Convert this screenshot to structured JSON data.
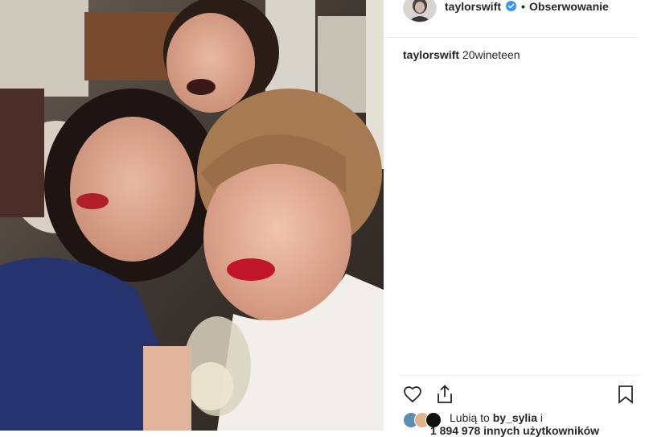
{
  "post": {
    "username": "taylorswift",
    "separator": "•",
    "follow_status": "Obserwowanie",
    "caption_user": "taylorswift",
    "caption_text": "20wineteen"
  },
  "likes": {
    "prefix": "Lubią to",
    "user": "by_sylia",
    "suffix": "i",
    "others": "1 894 978 innych użytkowników"
  },
  "icons": {
    "verified": "verified-badge-icon",
    "like": "heart-icon",
    "share": "share-icon",
    "save": "bookmark-icon"
  },
  "colors": {
    "verified_blue": "#3897f0",
    "text": "#262626",
    "divider": "#efefef"
  }
}
